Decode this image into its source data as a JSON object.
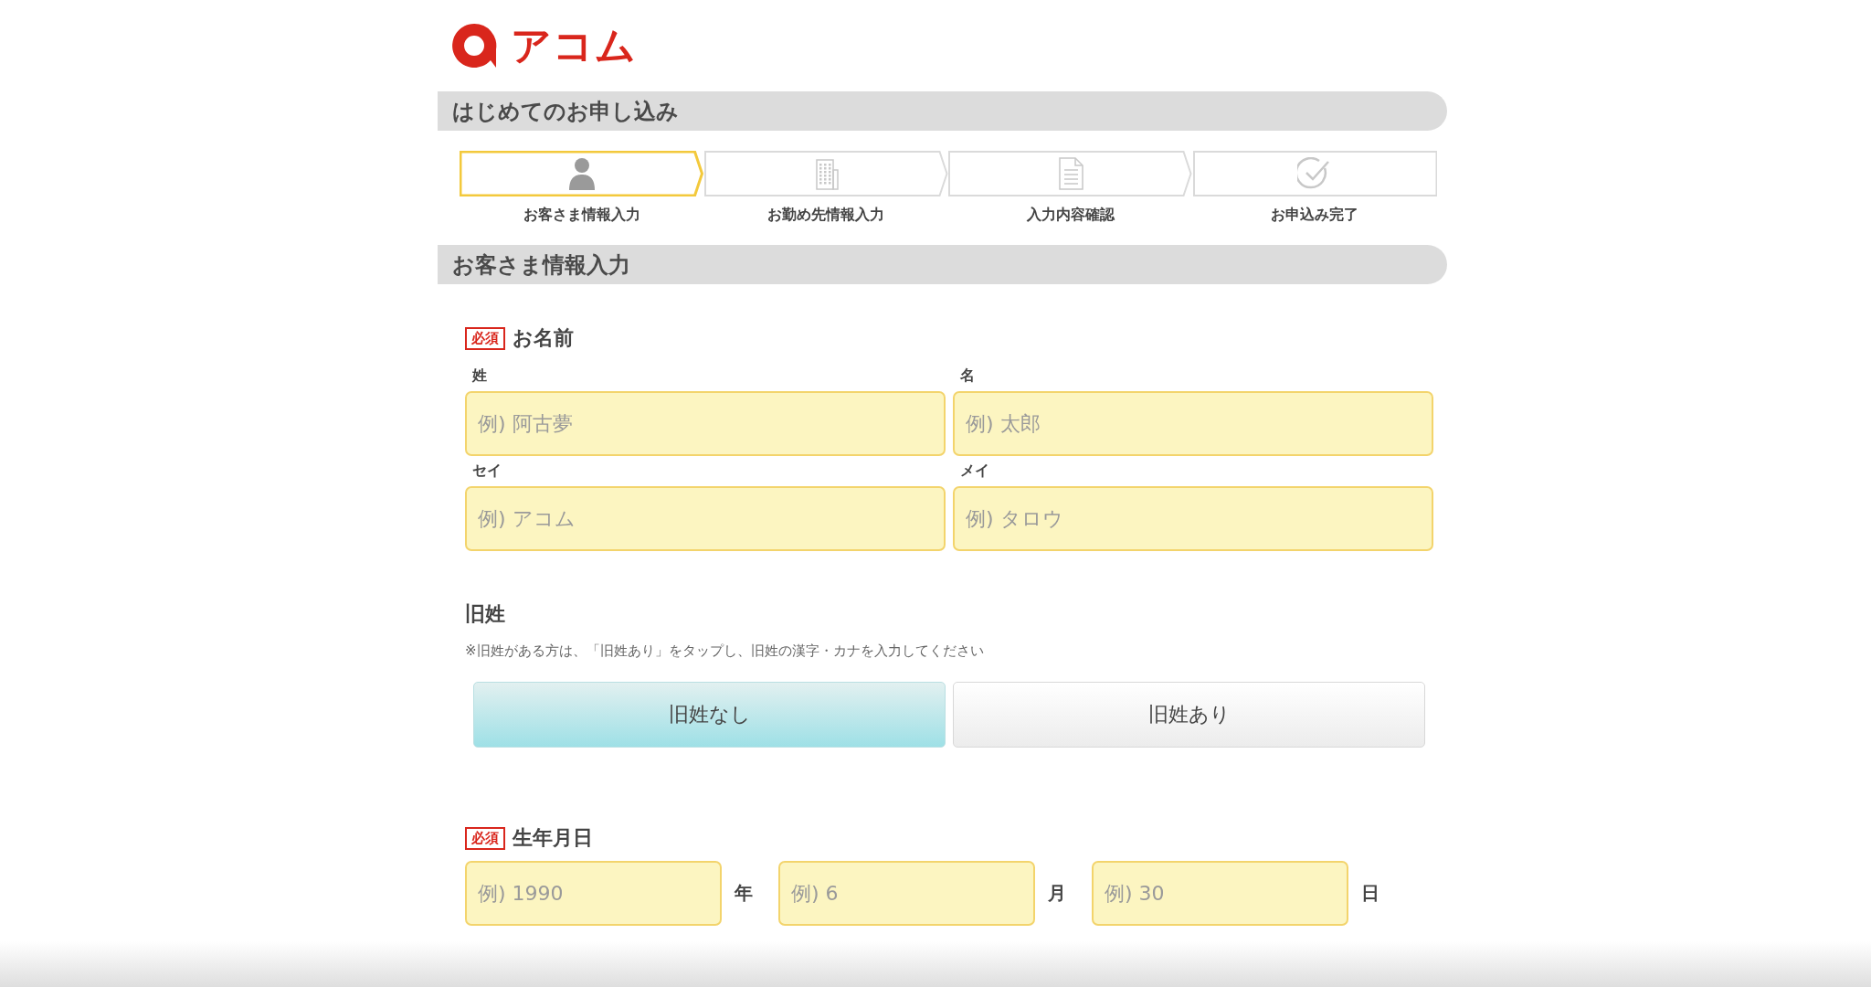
{
  "logo": {
    "text": "アコム"
  },
  "page_heading": "はじめてのお申し込み",
  "steps": [
    {
      "label": "お客さま情報入力",
      "kind": "person",
      "selected": true
    },
    {
      "label": "お勤め先情報入力",
      "kind": "building",
      "selected": false
    },
    {
      "label": "入力内容確認",
      "kind": "document",
      "selected": false
    },
    {
      "label": "お申込み完了",
      "kind": "check",
      "selected": false
    }
  ],
  "section_heading": "お客さま情報入力",
  "name_group": {
    "required_badge": "必須",
    "label": "お名前",
    "fields": [
      {
        "label": "姓",
        "placeholder": "例) 阿古夢"
      },
      {
        "label": "名",
        "placeholder": "例) 太郎"
      },
      {
        "label": "セイ",
        "placeholder": "例) アコム"
      },
      {
        "label": "メイ",
        "placeholder": "例) タロウ"
      }
    ]
  },
  "maiden_name": {
    "label": "旧姓",
    "note": "※旧姓がある方は、「旧姓あり」をタップし、旧姓の漢字・カナを入力してください",
    "options": [
      {
        "label": "旧姓なし",
        "selected": true
      },
      {
        "label": "旧姓あり",
        "selected": false
      }
    ]
  },
  "birth_date": {
    "required_badge": "必須",
    "label": "生年月日",
    "fields": [
      {
        "placeholder": "例) 1990",
        "unit": "年"
      },
      {
        "placeholder": "例) 6",
        "unit": "月"
      },
      {
        "placeholder": "例) 30",
        "unit": "日"
      }
    ]
  }
}
